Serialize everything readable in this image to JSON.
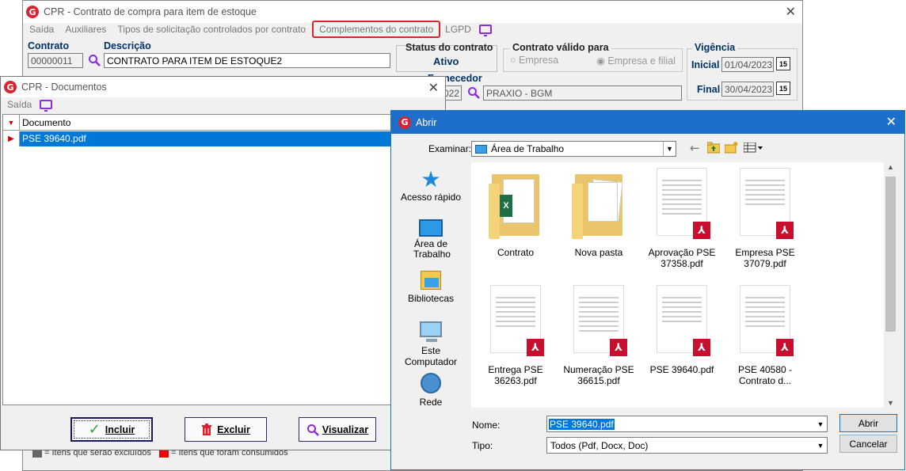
{
  "main_window": {
    "title": "CPR - Contrato de compra para item de estoque",
    "menu": [
      "Saída",
      "Auxiliares",
      "Tipos de solicitação controlados por contrato",
      "Complementos do contrato",
      "LGPD"
    ],
    "contrato_label": "Contrato",
    "contrato_value": "00000011",
    "descricao_label": "Descrição",
    "descricao_value": "CONTRATO PARA ITEM DE ESTOQUE2",
    "status_label": "Status do contrato",
    "status_value": "Ativo",
    "valido_label": "Contrato válido para",
    "valido_opt1": "Empresa",
    "valido_opt2": "Empresa e filial",
    "vigencia_label": "Vigência",
    "inicial_label": "Inicial",
    "inicial_value": "01/04/2023",
    "final_label": "Final",
    "final_value": "30/04/2023",
    "fornecedor_label": "Fornecedor",
    "fornecedor_code": "022",
    "fornecedor_name": "PRAXIO - BGM",
    "legend_excluded": "= Itens que serão excluídos",
    "legend_consumed": "= Itens que foram consumidos"
  },
  "docs_window": {
    "title": "CPR - Documentos",
    "menu_saida": "Saída",
    "column_header": "Documento",
    "rows": [
      "PSE 39640.pdf"
    ],
    "btn_incluir": "Incluir",
    "btn_excluir": "Excluir",
    "btn_visualizar": "Visualizar"
  },
  "open_dialog": {
    "title": "Abrir",
    "examinar_label": "Examinar:",
    "examinar_value": "Área de Trabalho",
    "nav": [
      "Acesso rápido",
      "Área de Trabalho",
      "Bibliotecas",
      "Este Computador",
      "Rede"
    ],
    "files": [
      {
        "name": "Contrato",
        "kind": "folder-excel"
      },
      {
        "name": "Nova pasta",
        "kind": "folder-docs"
      },
      {
        "name": "Aprovação PSE 37358.pdf",
        "kind": "pdf"
      },
      {
        "name": "Empresa PSE 37079.pdf",
        "kind": "pdf"
      },
      {
        "name": "Entrega PSE 36263.pdf",
        "kind": "pdf"
      },
      {
        "name": "Numeração PSE 36615.pdf",
        "kind": "pdf"
      },
      {
        "name": "PSE 39640.pdf",
        "kind": "pdf"
      },
      {
        "name": "PSE 40580 - Contrato d...",
        "kind": "pdf"
      }
    ],
    "nome_label": "Nome:",
    "nome_value": "PSE 39640.pdf",
    "tipo_label": "Tipo:",
    "tipo_value": "Todos (Pdf, Docx, Doc)",
    "btn_abrir": "Abrir",
    "btn_cancelar": "Cancelar"
  },
  "colors": {
    "highlight_border": "#d9232e",
    "selection_blue": "#0078d7",
    "label_blue": "#003366",
    "pdf_red": "#c8102e",
    "purple_icon": "#8a2be2"
  }
}
